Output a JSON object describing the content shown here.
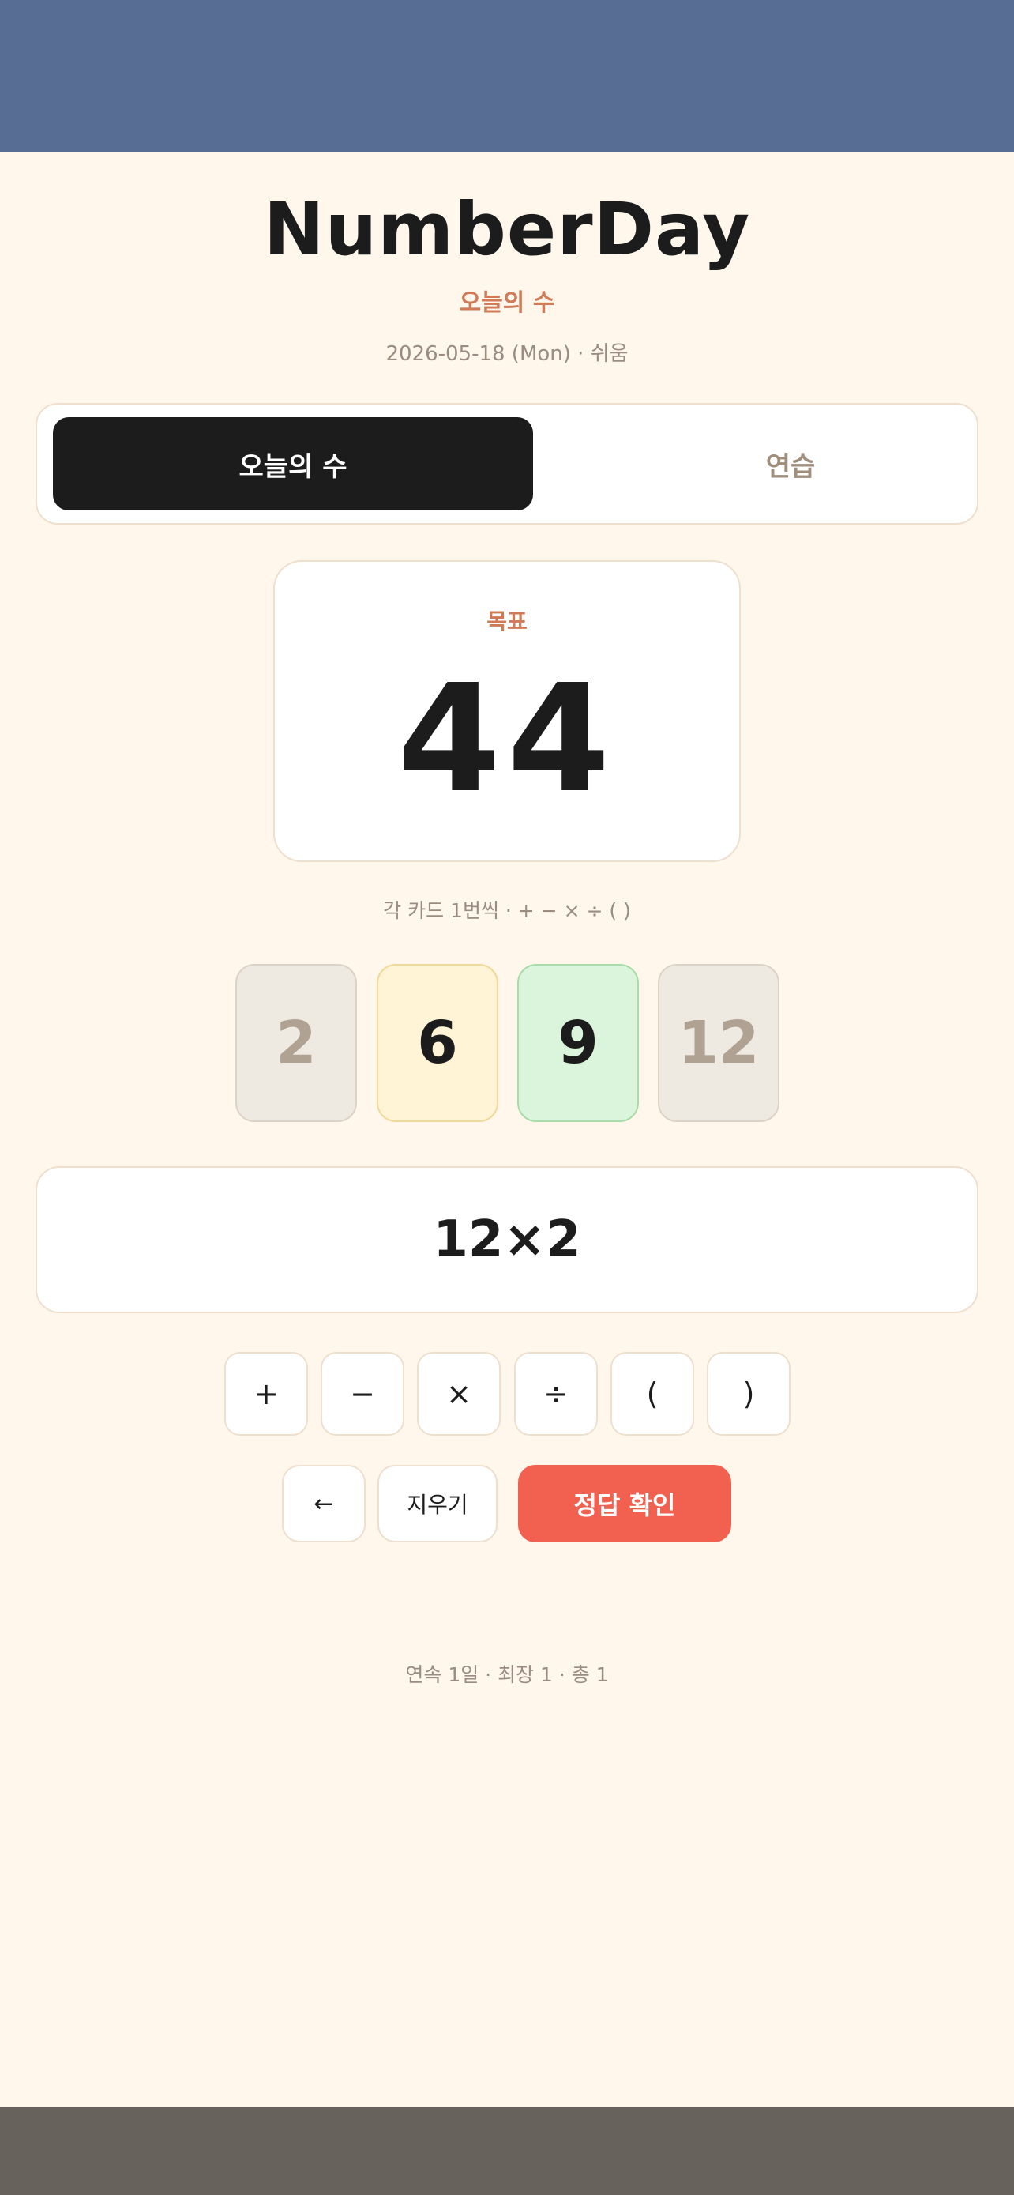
{
  "app": {
    "title": "NumberDay",
    "subtitle": "오늘의 수",
    "date_line": "2026-05-18 (Mon) · 쉬움"
  },
  "tabs": [
    {
      "label": "오늘의 수",
      "active": true
    },
    {
      "label": "연습",
      "active": false
    }
  ],
  "target": {
    "label": "목표",
    "value": "44"
  },
  "rules_hint": "각 카드 1번씩 · + − × ÷ ( )",
  "cards": [
    {
      "value": "2",
      "state": "used"
    },
    {
      "value": "6",
      "state": "highlight-yellow"
    },
    {
      "value": "9",
      "state": "highlight-green"
    },
    {
      "value": "12",
      "state": "used"
    }
  ],
  "expression": "12×2",
  "operators": [
    "+",
    "−",
    "×",
    "÷",
    "(",
    ")"
  ],
  "actions": {
    "backspace": "←",
    "clear": "지우기",
    "submit": "정답 확인"
  },
  "stats": "연속 1일 · 최장 1 · 총 1",
  "colors": {
    "background": "#FFF6EC",
    "top_band": "#586D93",
    "bottom_band": "#68625D",
    "accent": "#D07A58",
    "submit": "#F26150"
  }
}
